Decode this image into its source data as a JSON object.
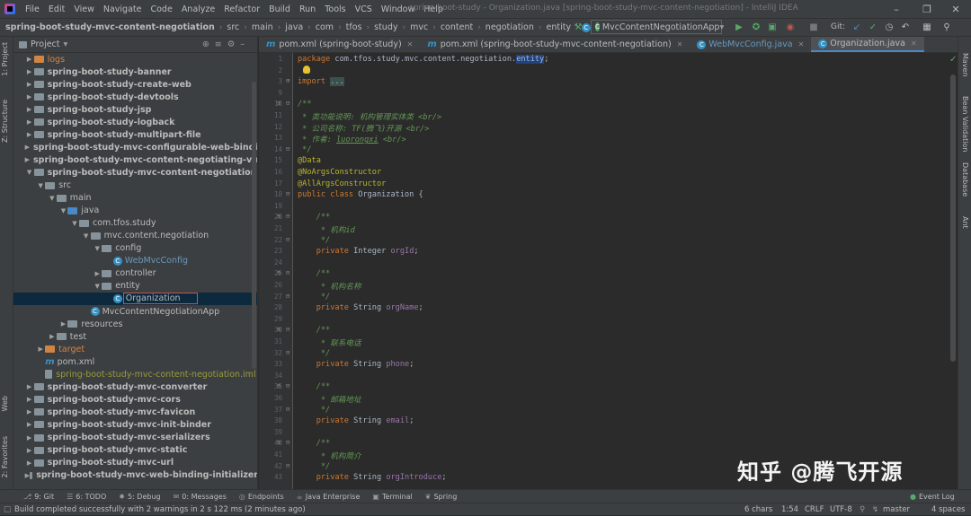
{
  "menu": [
    "File",
    "Edit",
    "View",
    "Navigate",
    "Code",
    "Analyze",
    "Refactor",
    "Build",
    "Run",
    "Tools",
    "VCS",
    "Window",
    "Help"
  ],
  "window_title": "spring-boot-study - Organization.java [spring-boot-study-mvc-content-negotiation] - IntelliJ IDEA",
  "breadcrumbs": [
    "spring-boot-study-mvc-content-negotiation",
    "src",
    "main",
    "java",
    "com",
    "tfos",
    "study",
    "mvc",
    "content",
    "negotiation",
    "entity",
    "Organization"
  ],
  "run_config": "MvcContentNegotiationApp",
  "git_label": "Git:",
  "left_tabs": [
    "1: Project",
    "Z: Structure",
    "Web",
    "2: Favorites"
  ],
  "right_tabs": [
    "Maven",
    "Bean Validation",
    "Database",
    "Ant"
  ],
  "project": {
    "header": "Project",
    "tree": [
      {
        "label": "logs",
        "style": "orange-folder"
      },
      {
        "label": "spring-boot-study-banner",
        "style": "module"
      },
      {
        "label": "spring-boot-study-create-web",
        "style": "module"
      },
      {
        "label": "spring-boot-study-devtools",
        "style": "module"
      },
      {
        "label": "spring-boot-study-jsp",
        "style": "module"
      },
      {
        "label": "spring-boot-study-logback",
        "style": "module"
      },
      {
        "label": "spring-boot-study-multipart-file",
        "style": "module"
      },
      {
        "label": "spring-boot-study-mvc-configurable-web-binding-ini",
        "style": "module"
      },
      {
        "label": "spring-boot-study-mvc-content-negotiating-view-res",
        "style": "module"
      },
      {
        "label": "spring-boot-study-mvc-content-negotiation",
        "style": "module-open"
      },
      {
        "label": "src",
        "style": "folder"
      },
      {
        "label": "main",
        "style": "folder"
      },
      {
        "label": "java",
        "style": "blue-folder"
      },
      {
        "label": "com.tfos.study",
        "style": "pkg"
      },
      {
        "label": "mvc.content.negotiation",
        "style": "pkg"
      },
      {
        "label": "config",
        "style": "pkg"
      },
      {
        "label": "WebMvcConfig",
        "style": "class"
      },
      {
        "label": "controller",
        "style": "pkg-closed"
      },
      {
        "label": "entity",
        "style": "pkg"
      },
      {
        "label": "Organization",
        "style": "class-selected"
      },
      {
        "label": "MvcContentNegotiationApp",
        "style": "class-app"
      },
      {
        "label": "resources",
        "style": "folder-closed"
      },
      {
        "label": "test",
        "style": "folder-closed"
      },
      {
        "label": "target",
        "style": "orange-closed"
      },
      {
        "label": "pom.xml",
        "style": "pom"
      },
      {
        "label": "spring-boot-study-mvc-content-negotiation.iml",
        "style": "iml"
      },
      {
        "label": "spring-boot-study-mvc-converter",
        "style": "module"
      },
      {
        "label": "spring-boot-study-mvc-cors",
        "style": "module"
      },
      {
        "label": "spring-boot-study-mvc-favicon",
        "style": "module"
      },
      {
        "label": "spring-boot-study-mvc-init-binder",
        "style": "module"
      },
      {
        "label": "spring-boot-study-mvc-serializers",
        "style": "module"
      },
      {
        "label": "spring-boot-study-mvc-static",
        "style": "module"
      },
      {
        "label": "spring-boot-study-mvc-url",
        "style": "module"
      },
      {
        "label": "spring-boot-study-mvc-web-binding-initializer",
        "style": "module"
      }
    ]
  },
  "editor_tabs": [
    {
      "label": "pom.xml (spring-boot-study)",
      "type": "maven"
    },
    {
      "label": "pom.xml (spring-boot-study-mvc-content-negotiation)",
      "type": "maven"
    },
    {
      "label": "WebMvcConfig.java",
      "type": "class"
    },
    {
      "label": "Organization.java",
      "type": "class-active"
    }
  ],
  "code_lines": [
    {
      "n": "1",
      "html": "<span class='kw'>package</span> com.tfos.study.mvc.content.negotiation.<span class='hl'>entity</span>;"
    },
    {
      "n": "2",
      "html": ""
    },
    {
      "n": "3",
      "html": "<span class='kw'>import</span> <span class='fold'>...</span>"
    },
    {
      "n": "9",
      "html": ""
    },
    {
      "n": "10",
      "html": "<span class='doc'>/**</span>"
    },
    {
      "n": "11",
      "html": "<span class='doc'> * 类功能说明: 机构管理实体类 &lt;br/&gt;</span>"
    },
    {
      "n": "12",
      "html": "<span class='doc'> * 公司名称: TF(腾飞)开源 &lt;br/&gt;</span>"
    },
    {
      "n": "13",
      "html": "<span class='doc'> * 作者: <u>luorongxi</u> &lt;br/&gt;</span>"
    },
    {
      "n": "14",
      "html": "<span class='doc'> */</span>"
    },
    {
      "n": "15",
      "html": "<span class='ann'>@Data</span>"
    },
    {
      "n": "16",
      "html": "<span class='ann'>@NoArgsConstructor</span>"
    },
    {
      "n": "17",
      "html": "<span class='ann'>@AllArgsConstructor</span>"
    },
    {
      "n": "18",
      "html": "<span class='kw'>public class</span> Organization {"
    },
    {
      "n": "19",
      "html": ""
    },
    {
      "n": "20",
      "html": "    <span class='doc'>/**</span>"
    },
    {
      "n": "21",
      "html": "<span class='doc'>     * 机构id</span>"
    },
    {
      "n": "22",
      "html": "<span class='doc'>     */</span>"
    },
    {
      "n": "23",
      "html": "    <span class='kw'>private</span> Integer <span class='field'>orgId</span>;"
    },
    {
      "n": "24",
      "html": ""
    },
    {
      "n": "25",
      "html": "    <span class='doc'>/**</span>"
    },
    {
      "n": "26",
      "html": "<span class='doc'>     * 机构名称</span>"
    },
    {
      "n": "27",
      "html": "<span class='doc'>     */</span>"
    },
    {
      "n": "28",
      "html": "    <span class='kw'>private</span> String <span class='field'>orgName</span>;"
    },
    {
      "n": "29",
      "html": ""
    },
    {
      "n": "30",
      "html": "    <span class='doc'>/**</span>"
    },
    {
      "n": "31",
      "html": "<span class='doc'>     * 联系电话</span>"
    },
    {
      "n": "32",
      "html": "<span class='doc'>     */</span>"
    },
    {
      "n": "33",
      "html": "    <span class='kw'>private</span> String <span class='field'>phone</span>;"
    },
    {
      "n": "34",
      "html": ""
    },
    {
      "n": "35",
      "html": "    <span class='doc'>/**</span>"
    },
    {
      "n": "36",
      "html": "<span class='doc'>     * 邮箱地址</span>"
    },
    {
      "n": "37",
      "html": "<span class='doc'>     */</span>"
    },
    {
      "n": "38",
      "html": "    <span class='kw'>private</span> String <span class='field'>email</span>;"
    },
    {
      "n": "39",
      "html": ""
    },
    {
      "n": "40",
      "html": "    <span class='doc'>/**</span>"
    },
    {
      "n": "41",
      "html": "<span class='doc'>     * 机构简介</span>"
    },
    {
      "n": "42",
      "html": "<span class='doc'>     */</span>"
    },
    {
      "n": "43",
      "html": "    <span class='kw'>private</span> String <span class='field'>orgIntroduce</span>;"
    }
  ],
  "bottom_tabs": [
    "9: Git",
    "6: TODO",
    "5: Debug",
    "0: Messages",
    "Endpoints",
    "Java Enterprise",
    "Terminal",
    "Spring"
  ],
  "event_log": "Event Log",
  "status": {
    "message": "Build completed successfully with 2 warnings in 2 s 122 ms (2 minutes ago)",
    "chars": "6 chars",
    "position": "1:54",
    "line_sep": "CRLF",
    "encoding": "UTF-8",
    "branch": "master",
    "indent": "4 spaces"
  },
  "watermark": "知乎 @腾飞开源"
}
